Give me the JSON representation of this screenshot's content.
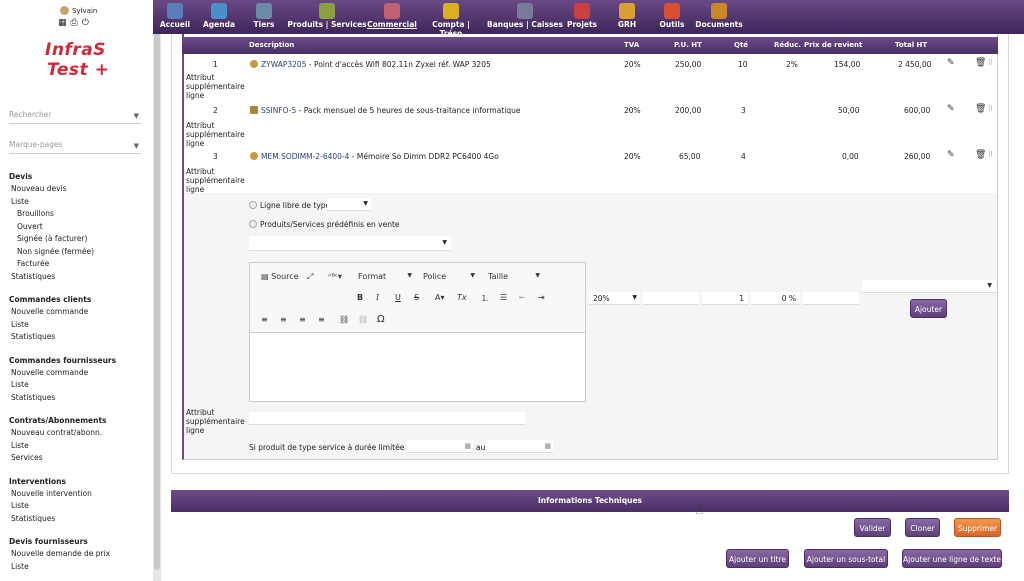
{
  "user": {
    "name": "Sylvain"
  },
  "logo": {
    "line1": "InfraS",
    "line2": "Test +"
  },
  "sidebar": {
    "search_placeholder": "Rechercher",
    "bookmarks_placeholder": "Marque-pages",
    "sections": [
      {
        "title": "Devis",
        "items": [
          "Nouveau devis",
          "Liste"
        ],
        "subitems": [
          "Brouillons",
          "Ouvert",
          "Signée (à facturer)",
          "Non signée (fermée)",
          "Facturée"
        ],
        "after": [
          "Statistiques"
        ]
      },
      {
        "title": "Commandes clients",
        "items": [
          "Nouvelle commande",
          "Liste",
          "Statistiques"
        ]
      },
      {
        "title": "Commandes fournisseurs",
        "items": [
          "Nouvelle commande",
          "Liste",
          "Statistiques"
        ]
      },
      {
        "title": "Contrats/Abonnements",
        "items": [
          "Nouveau contrat/abonn.",
          "Liste",
          "Services"
        ]
      },
      {
        "title": "Interventions",
        "items": [
          "Nouvelle intervention",
          "Liste",
          "Statistiques"
        ]
      },
      {
        "title": "Devis fournisseurs",
        "items": [
          "Nouvelle demande de prix",
          "Liste"
        ]
      }
    ]
  },
  "nav": [
    {
      "label": "Accueil",
      "color": "#5b7db8",
      "icon": "home-icon"
    },
    {
      "label": "Agenda",
      "color": "#4a8fc8",
      "icon": "calendar-icon"
    },
    {
      "label": "Tiers",
      "color": "#6a8aa8",
      "icon": "building-icon"
    },
    {
      "label": "Produits | Services",
      "color": "#8aa040",
      "icon": "products-icon"
    },
    {
      "label": "Commercial",
      "color": "#c06070",
      "icon": "handshake-icon"
    },
    {
      "label": "Compta | Tréso",
      "color": "#d8b020",
      "icon": "money-icon"
    },
    {
      "label": "Banques | Caisses",
      "color": "#7a7a9a",
      "icon": "bank-icon"
    },
    {
      "label": "Projets",
      "color": "#c84040",
      "icon": "projects-icon"
    },
    {
      "label": "GRH",
      "color": "#d8a030",
      "icon": "hr-icon"
    },
    {
      "label": "Outils",
      "color": "#d85030",
      "icon": "tools-icon"
    },
    {
      "label": "Documents",
      "color": "#c8882a",
      "icon": "folder-icon"
    }
  ],
  "table": {
    "headers": {
      "description": "Description",
      "tva": "TVA",
      "pu": "P.U. HT",
      "qty": "Qté",
      "reduc": "Réduc.",
      "cost": "Prix de revient",
      "total": "Total HT"
    },
    "rows": [
      {
        "num": "1",
        "ref": "ZYWAP3205",
        "label": " - Point d'accès Wifi 802.11n Zyxel réf. WAP 3205",
        "tva": "20%",
        "pu": "250,00",
        "qty": "10",
        "reduc": "2%",
        "cost": "154,00",
        "total": "2 450,00",
        "attr": "Attribut supplémentaire ligne"
      },
      {
        "num": "2",
        "ref": "SSINFO-5",
        "label": " - Pack mensuel de 5 heures de sous-traitance informatique",
        "tva": "20%",
        "pu": "200,00",
        "qty": "3",
        "reduc": "",
        "cost": "50,00",
        "total": "600,00",
        "attr": "Attribut supplémentaire ligne"
      },
      {
        "num": "3",
        "ref": "MEM.SODIMM-2-6400-4",
        "label": " - Mémoire So Dimm DDR2 PC6400 4Go",
        "tva": "20%",
        "pu": "65,00",
        "qty": "4",
        "reduc": "",
        "cost": "0,00",
        "total": "260,00",
        "attr": "Attribut supplémentaire ligne"
      }
    ]
  },
  "addline": {
    "free_line_label": "Ligne libre de type",
    "predefined_label": "Produits/Services prédéfinis en vente",
    "editor": {
      "source": "Source",
      "format": "Format",
      "police": "Police",
      "taille": "Taille"
    },
    "tva_value": "20%",
    "qty_value": "1",
    "reduc_value": "0",
    "reduc_unit": "%",
    "add_button": "Ajouter",
    "attr_label": "Attribut supplémentaire ligne",
    "service_label": "Si produit de type service à durée limitée : Du",
    "au_label": "au"
  },
  "tech_bar": "Informations Techniques",
  "buttons": {
    "valider": "Valider",
    "cloner": "Cloner",
    "supprimer": "Supprimer",
    "add_title": "Ajouter un titre",
    "add_subtotal": "Ajouter un sous-total",
    "add_text": "Ajouter une ligne de texte"
  }
}
